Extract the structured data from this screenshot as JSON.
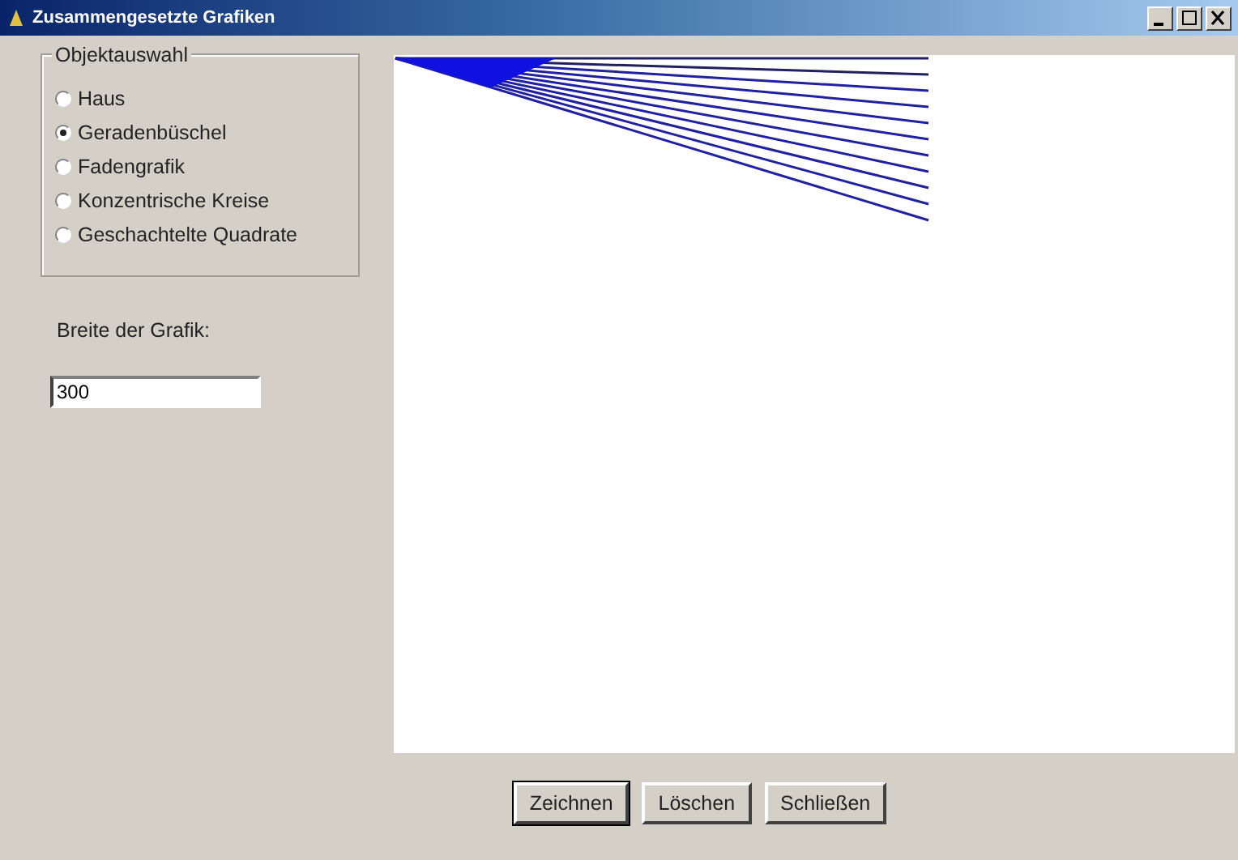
{
  "window": {
    "title": "Zusammengesetzte Grafiken"
  },
  "object_group": {
    "title": "Objektauswahl",
    "options": [
      {
        "label": "Haus",
        "selected": false
      },
      {
        "label": "Geradenbüschel",
        "selected": true
      },
      {
        "label": "Fadengrafik",
        "selected": false
      },
      {
        "label": "Konzentrische Kreise",
        "selected": false
      },
      {
        "label": "Geschachtelte Quadrate",
        "selected": false
      }
    ]
  },
  "width_label": "Breite der Grafik:",
  "width_field": {
    "value": "300"
  },
  "buttons": [
    {
      "label": "Zeichnen",
      "default": true
    },
    {
      "label": "Löschen",
      "default": false
    },
    {
      "label": "Schließen",
      "default": false
    }
  ]
}
